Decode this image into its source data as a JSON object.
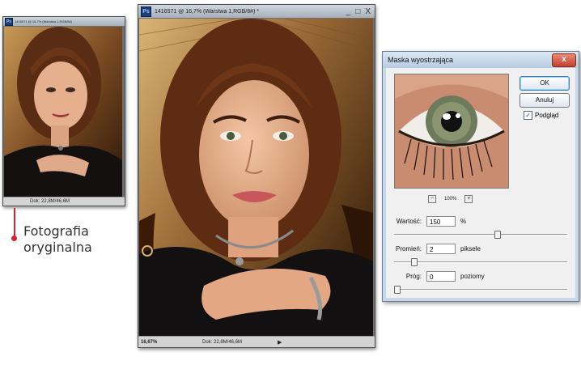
{
  "small_window": {
    "title": "1416571 @ 16,7% (Warstwa 1,RGB/8#)",
    "status": "Dok: 22,8M/46,6M"
  },
  "large_window": {
    "title": "1416571 @ 16,7% (Warstwa 1,RGB/8#) *",
    "zoom": "16,67%",
    "status": "Dok: 22,8M/46,6M",
    "minimize_glyph": "_",
    "maximize_glyph": "□",
    "close_glyph": "X"
  },
  "caption": {
    "line1": "Fotografia",
    "line2": "oryginalna"
  },
  "dialog": {
    "title": "Maska wyostrzająca",
    "close_glyph": "x",
    "ok_label": "OK",
    "cancel_label": "Anuluj",
    "preview_checkbox_label": "Podgląd",
    "preview_checked": true,
    "zoom_level": "100%",
    "zoom_out_glyph": "−",
    "zoom_in_glyph": "+",
    "amount": {
      "label": "Wartość:",
      "value": "150",
      "unit": "%",
      "level": 0.6
    },
    "radius": {
      "label": "Promień:",
      "value": "2",
      "unit": "piksele",
      "level": 0.1
    },
    "threshold": {
      "label": "Próg:",
      "value": "0",
      "unit": "poziomy",
      "level": 0.0
    }
  },
  "colors": {
    "marker": "#d6242f",
    "dialog_frame": "#c9d8e9",
    "photo_background": "#2b1a10"
  }
}
